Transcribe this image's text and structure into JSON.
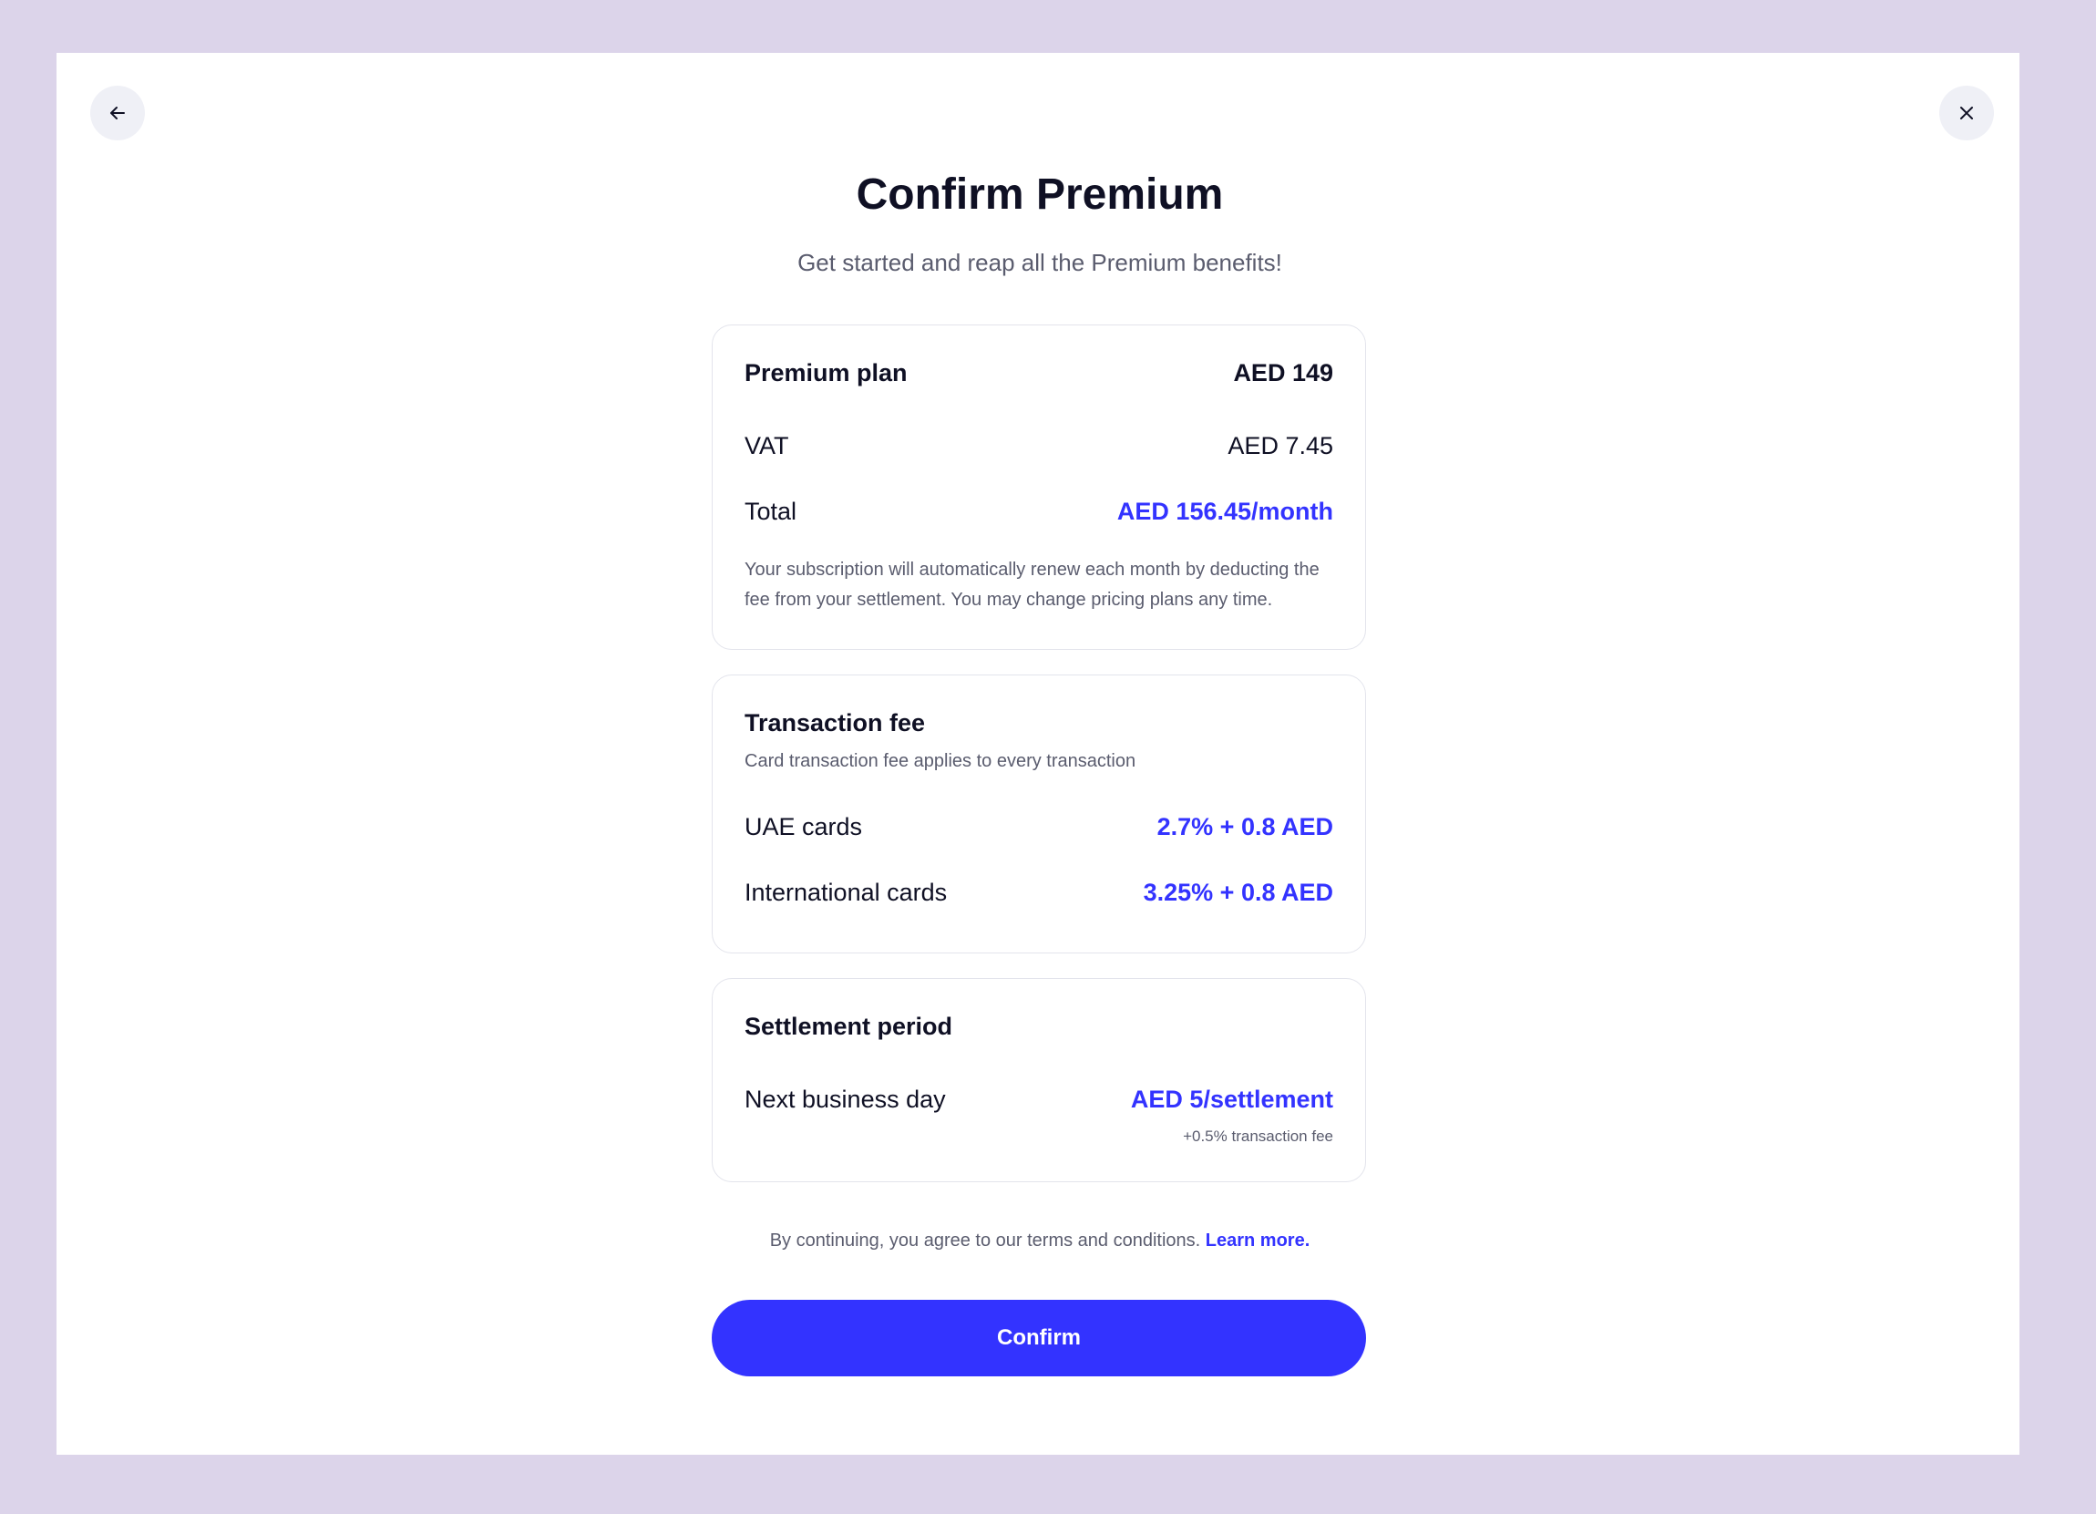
{
  "colors": {
    "background": "#dcd4ea",
    "accent": "#3333ff",
    "text": "#0f1024",
    "muted": "#5a5c6e",
    "icon_button_bg": "#eff0f6"
  },
  "header": {
    "back_icon": "arrow-left-icon",
    "close_icon": "close-icon",
    "title": "Confirm Premium",
    "subtitle": "Get started and reap all the Premium benefits!"
  },
  "plan": {
    "name_label": "Premium plan",
    "name_value": "AED 149",
    "vat_label": "VAT",
    "vat_value": "AED 7.45",
    "total_label": "Total",
    "total_value": "AED 156.45/month",
    "note": "Your subscription will automatically renew each month by deducting the fee from your settlement. You may change pricing plans any time."
  },
  "transaction_fee": {
    "heading": "Transaction fee",
    "description": "Card transaction fee applies to every transaction",
    "rows": [
      {
        "label": "UAE cards",
        "value": "2.7% + 0.8 AED"
      },
      {
        "label": "International cards",
        "value": "3.25% + 0.8 AED"
      }
    ]
  },
  "settlement": {
    "heading": "Settlement period",
    "label": "Next business day",
    "value": "AED 5/settlement",
    "sub_value": "+0.5% transaction fee"
  },
  "footer": {
    "terms_text": "By continuing, you agree to our terms and conditions.",
    "terms_link": "Learn more.",
    "confirm_label": "Confirm"
  }
}
